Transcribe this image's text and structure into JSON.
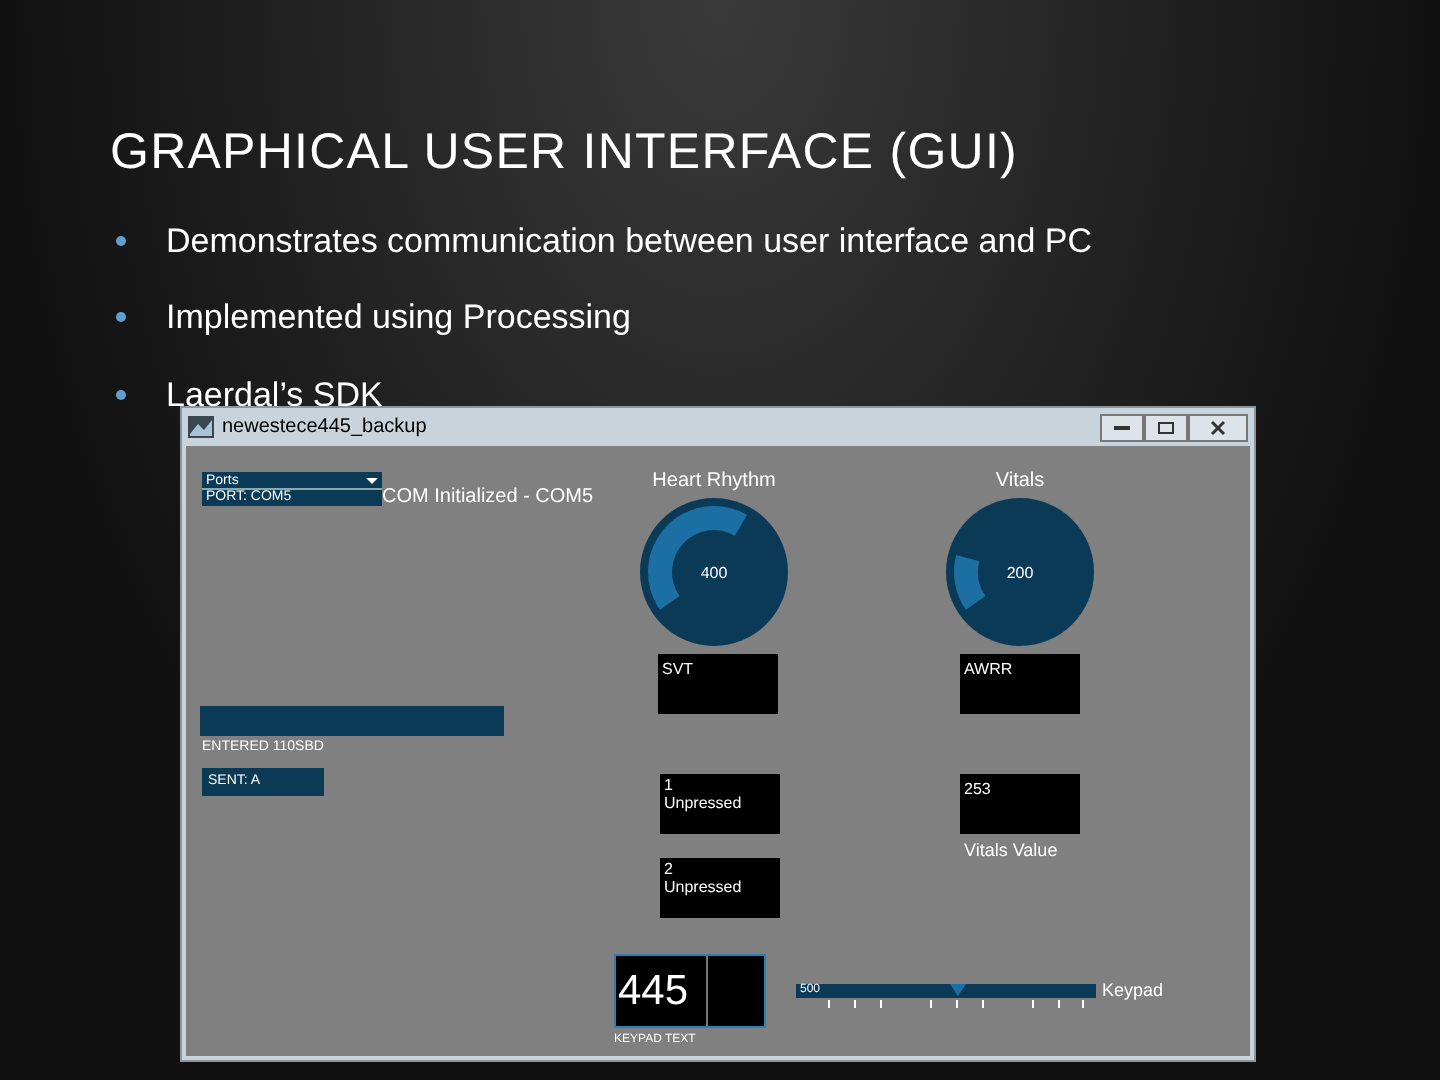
{
  "slide": {
    "title": "GRAPHICAL USER INTERFACE (GUI)",
    "bullets": [
      {
        "text": "Demonstrates communication between user interface and PC"
      },
      {
        "text": "Implemented using Processing"
      },
      {
        "text": "Laerdal’s SDK"
      }
    ]
  },
  "window": {
    "title": "newestece445_backup",
    "ports_dropdown": {
      "label": "Ports",
      "items": [
        "PORT: COM5"
      ]
    },
    "status": "COM Initialized - COM5",
    "knobs": [
      {
        "label": "Heart Rhythm",
        "value": "400"
      },
      {
        "label": "Vitals",
        "value": "200"
      }
    ],
    "rhythm_boxes": [
      {
        "text": "SVT"
      },
      {
        "text": "AWRR"
      }
    ],
    "entered_bar": {
      "label": "ENTERED 110SBD"
    },
    "sent": "SENT: A",
    "buttons": [
      {
        "number": "1",
        "state": "Unpressed"
      },
      {
        "number": "2",
        "state": "Unpressed"
      }
    ],
    "vitals_box": {
      "value": "253",
      "label": "Vitals Value"
    },
    "keypad_display": {
      "value": "445",
      "label": "KEYPAD TEXT"
    },
    "slider": {
      "value": "500",
      "label": "Keypad",
      "level": 0.54
    }
  }
}
